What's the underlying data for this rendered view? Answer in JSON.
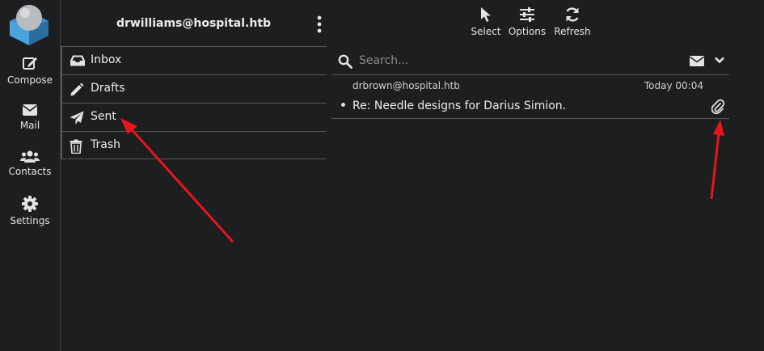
{
  "nav": {
    "items": [
      {
        "label": "Compose",
        "icon": "compose-icon"
      },
      {
        "label": "Mail",
        "icon": "envelope-icon"
      },
      {
        "label": "Contacts",
        "icon": "users-icon"
      },
      {
        "label": "Settings",
        "icon": "gear-icon"
      }
    ]
  },
  "account": {
    "email": "drwilliams@hospital.htb"
  },
  "folders": [
    {
      "label": "Inbox",
      "icon": "inbox-icon"
    },
    {
      "label": "Drafts",
      "icon": "pencil-icon"
    },
    {
      "label": "Sent",
      "icon": "paper-plane-icon"
    },
    {
      "label": "Trash",
      "icon": "trash-icon"
    }
  ],
  "toolbar": {
    "select_label": "Select",
    "options_label": "Options",
    "refresh_label": "Refresh"
  },
  "search": {
    "placeholder": "Search..."
  },
  "messages": [
    {
      "from": "drbrown@hospital.htb",
      "date": "Today 00:04",
      "subject": "Re: Needle designs for Darius Simion.",
      "has_attachment": true
    }
  ],
  "colors": {
    "background": "#1d1e20",
    "divider": "#57574f",
    "annotation_arrow": "#e8151b",
    "logo_blue": "#3a8fc8"
  }
}
